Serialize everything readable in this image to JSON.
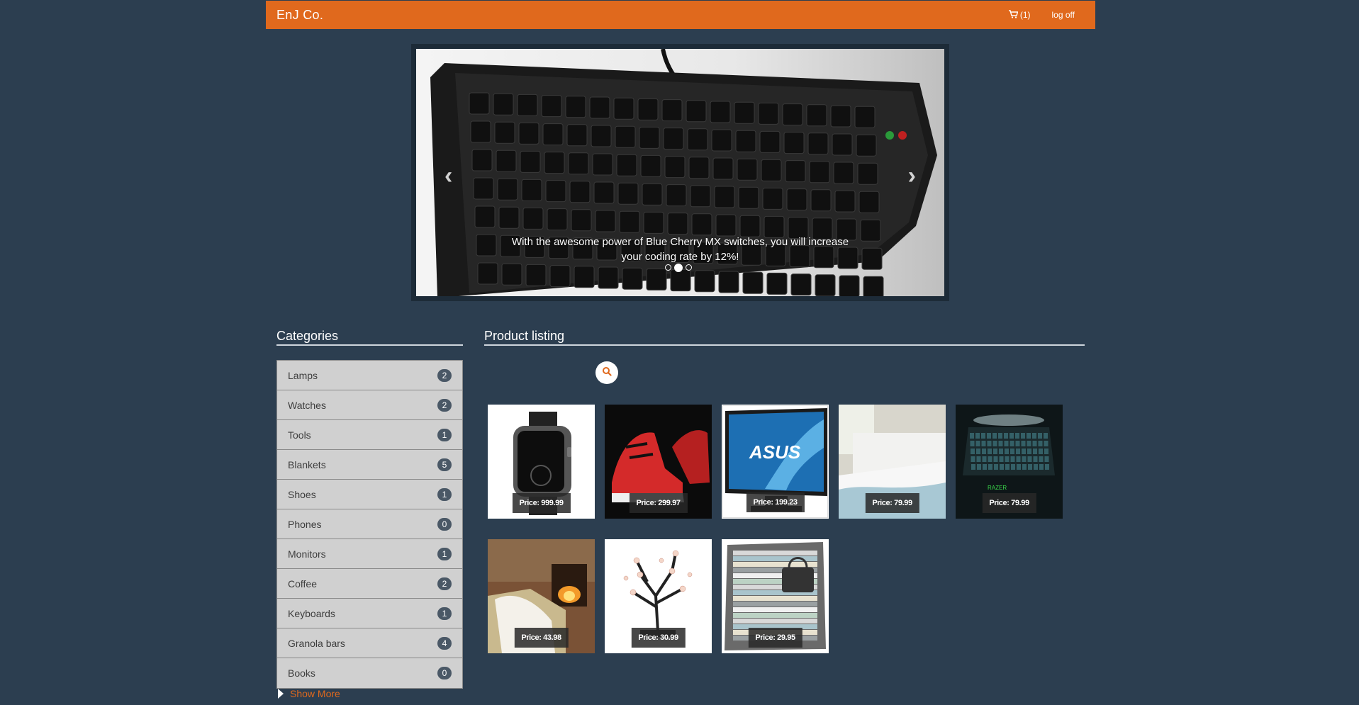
{
  "nav": {
    "brand": "EnJ Co.",
    "cart_count": "(1)",
    "logoff": "log off"
  },
  "carousel": {
    "caption": "With the awesome power of Blue Cherry MX switches, you will increase your coding rate by 12%!",
    "prev_icon": "chevron-left-icon",
    "next_icon": "chevron-right-icon",
    "active_index": 1
  },
  "categories": {
    "title": "Categories",
    "items": [
      {
        "label": "Lamps",
        "count": "2"
      },
      {
        "label": "Watches",
        "count": "2"
      },
      {
        "label": "Tools",
        "count": "1"
      },
      {
        "label": "Blankets",
        "count": "5"
      },
      {
        "label": "Shoes",
        "count": "1"
      },
      {
        "label": "Phones",
        "count": "0"
      },
      {
        "label": "Monitors",
        "count": "1"
      },
      {
        "label": "Coffee",
        "count": "2"
      },
      {
        "label": "Keyboards",
        "count": "1"
      },
      {
        "label": "Granola bars",
        "count": "4"
      },
      {
        "label": "Books",
        "count": "0"
      }
    ],
    "show_more": "Show More"
  },
  "products": {
    "title": "Product listing",
    "search_icon": "search-icon",
    "items": [
      {
        "price": "Price: 999.99"
      },
      {
        "price": "Price: 299.97"
      },
      {
        "price": "Price: 199.23"
      },
      {
        "price": "Price: 79.99"
      },
      {
        "price": "Price: 79.99"
      },
      {
        "price": "Price: 43.98"
      },
      {
        "price": "Price: 30.99"
      },
      {
        "price": "Price: 29.95"
      }
    ]
  },
  "colors": {
    "accent": "#e0691d",
    "background": "#2c3e50",
    "badge": "#4a5866"
  }
}
